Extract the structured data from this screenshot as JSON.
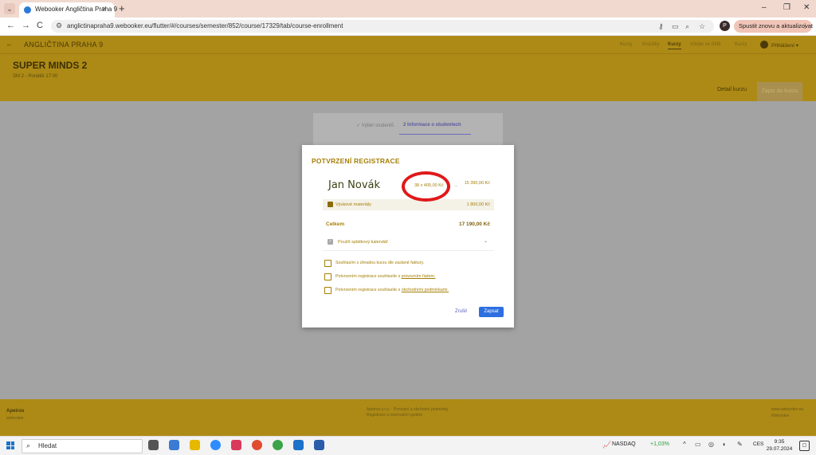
{
  "browser": {
    "tab_title": "Webooker Angličtina Praha 9",
    "tab_close": "×",
    "new_tab": "+",
    "url": "anglictinapraha9.webooker.eu/flutter/#/courses/semester/852/course/17329/tab/course-enrollment",
    "profile_initial": "P",
    "update_button": "Spustit znovu a aktualizovat",
    "update_menu": "⋮",
    "win_min": "–",
    "win_max": "❐",
    "win_close": "✕",
    "nav_back": "←",
    "nav_forward": "→",
    "nav_reload": "C"
  },
  "app": {
    "back_arrow": "←",
    "school_name": "ANGLIČTINA PRAHA 9",
    "nav": [
      "Kurzy",
      "Kroužky",
      "Kurzy",
      "Vítejte ve třídě",
      "Kurzy"
    ],
    "user": "Přihlášení",
    "user_chevron": "▾",
    "course_title": "SUPER MINDS 2",
    "course_subtitle": "SM 2 - Pondělí 17:00",
    "tab_detail": "Detail kurzu",
    "tab_enrollment": "Zápis do kurzu",
    "step1": "✓ Výběr studentů",
    "step2": "2  Informace o studentech"
  },
  "modal": {
    "title": "POTVRZENÍ REGISTRACE",
    "student_name": "Jan Novák",
    "lessons_calc": "38 x 405,00 Kč",
    "arrow": "→",
    "lessons_total": "15 390,00 Kč",
    "materials_label": "Výukové materiály",
    "materials_price": "1 800,00 Kč",
    "total_label": "Celkem",
    "total_value": "17 190,00 Kč",
    "discount_label": "Použít splátkový kalendář",
    "discount_check": "✓",
    "discount_chevron": "⌄",
    "checkboxes": [
      {
        "text": "Souhlasím s úhradou kurzu dle zaslané faktury."
      },
      {
        "text": "Potvrzením registrace souhlasíte s ",
        "link": "provozním řádem."
      },
      {
        "text": "Potvrzením registrace souhlasíte s ",
        "link": "obchodními podmínkami."
      }
    ],
    "cancel_button": "Zrušit",
    "start_button": "Zapsat"
  },
  "footer": {
    "brand": "Apeiros",
    "brand_sub": "webooker",
    "middle_1": "Apeiros s.r.o. · Provozní a obchodní podmínky",
    "middle_2": "Registrace a rezervační systém",
    "right_1": "www.webooker.eu",
    "right_2": "Webooker"
  },
  "taskbar": {
    "search_placeholder": "Hledat",
    "search_icon": "⌕",
    "nasdaq_label": "NASDAQ",
    "nasdaq_icon": "📈",
    "nasdaq_change": "+1,03%",
    "tray_chevron": "^",
    "lang": "CES",
    "time": "9:35",
    "date": "29.07.2024",
    "notif": "▢"
  },
  "colors": {
    "header_gold": "#ad8a16",
    "text_gold": "#a57e06",
    "primary_blue": "#2d6fe0",
    "annotation_red": "#e01919"
  }
}
